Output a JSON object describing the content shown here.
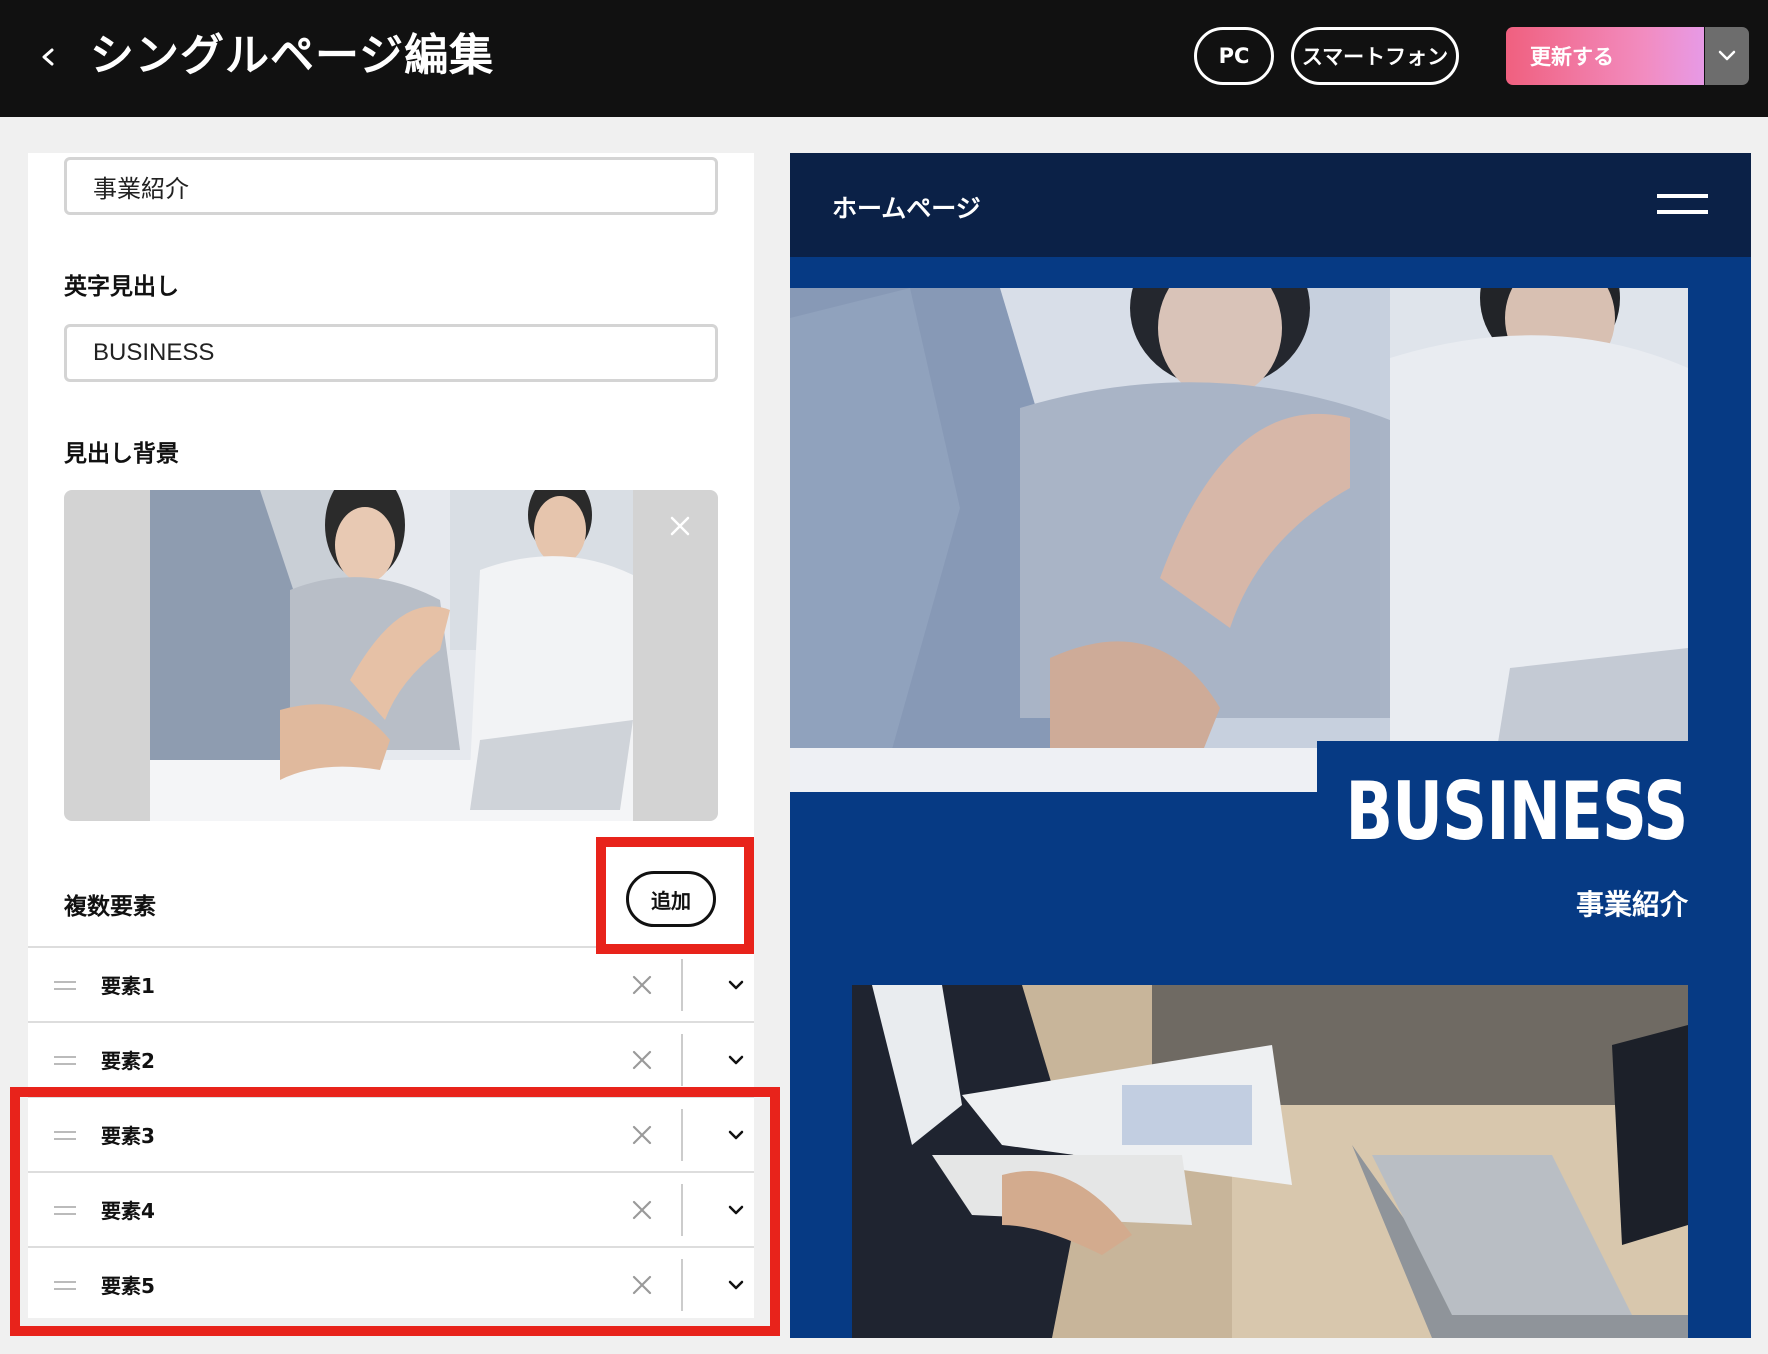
{
  "header": {
    "back_icon": "chevron-left-icon",
    "title": "シングルページ編集",
    "pc_label": "PC",
    "smartphone_label": "スマートフォン",
    "update_label": "更新する",
    "dropdown_icon": "chevron-down-icon"
  },
  "editor": {
    "heading_value": "事業紹介",
    "english_heading_label": "英字見出し",
    "english_heading_value": "BUSINESS",
    "heading_bg_label": "見出し背景",
    "multi_label": "複数要素",
    "add_label": "追加",
    "items": [
      {
        "label": "要素1"
      },
      {
        "label": "要素2"
      },
      {
        "label": "要素3"
      },
      {
        "label": "要素4"
      },
      {
        "label": "要素5"
      }
    ]
  },
  "preview": {
    "site_title": "ホームページ",
    "menu_icon": "hamburger-icon",
    "heading_en": "BUSINESS",
    "heading_ja": "事業紹介"
  },
  "colors": {
    "topbar": "#111111",
    "update_gradient_start": "#f0607f",
    "update_gradient_end": "#e79ae6",
    "preview_header": "#0b2147",
    "preview_bg": "#063a84",
    "highlight": "#e8231b"
  }
}
